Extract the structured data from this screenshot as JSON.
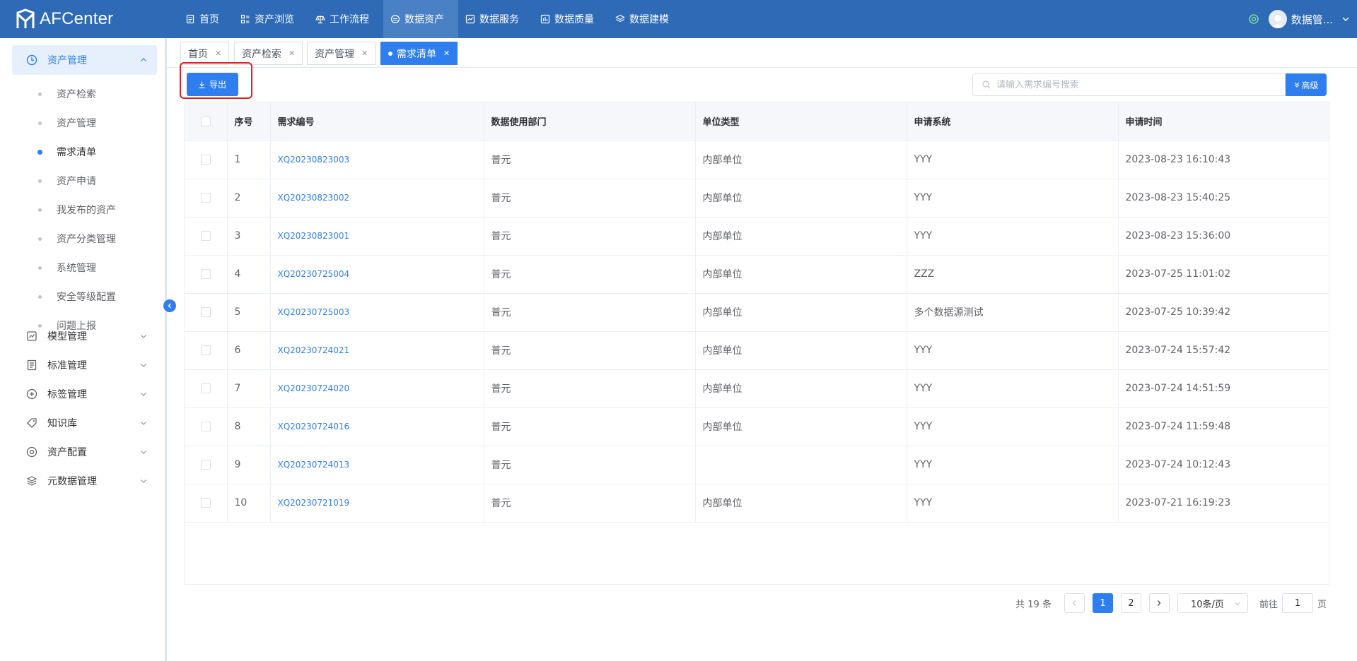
{
  "app": {
    "logo_text": "AFCenter",
    "user_name": "数据管...",
    "accent_color": "#2e7ef0",
    "header_color": "#2e6ab6"
  },
  "nav": [
    {
      "label": "首页",
      "icon": "document-icon",
      "active": false
    },
    {
      "label": "资产浏览",
      "icon": "grid-icon",
      "active": false
    },
    {
      "label": "工作流程",
      "icon": "balance-icon",
      "active": false
    },
    {
      "label": "数据资产",
      "icon": "database-icon",
      "active": true
    },
    {
      "label": "数据服务",
      "icon": "chart-icon",
      "active": false
    },
    {
      "label": "数据质量",
      "icon": "bar-chart-icon",
      "active": false
    },
    {
      "label": "数据建模",
      "icon": "layers-icon",
      "active": false
    }
  ],
  "sidebar": {
    "groups": [
      {
        "label": "资产管理",
        "icon": "clock-icon",
        "expanded": true,
        "active": true
      },
      {
        "label": "模型管理",
        "icon": "chart-box-icon"
      },
      {
        "label": "标准管理",
        "icon": "document-list-icon"
      },
      {
        "label": "标签管理",
        "icon": "plus-circle-icon"
      },
      {
        "label": "知识库",
        "icon": "tag-icon"
      },
      {
        "label": "资产配置",
        "icon": "target-icon"
      },
      {
        "label": "元数据管理",
        "icon": "stack-icon"
      }
    ],
    "sub_items": [
      {
        "label": "资产检索",
        "active": false
      },
      {
        "label": "资产管理",
        "active": false
      },
      {
        "label": "需求清单",
        "active": true
      },
      {
        "label": "资产申请",
        "active": false
      },
      {
        "label": "我发布的资产",
        "active": false
      },
      {
        "label": "资产分类管理",
        "active": false
      },
      {
        "label": "系统管理",
        "active": false
      },
      {
        "label": "安全等级配置",
        "active": false
      },
      {
        "label": "问题上报",
        "active": false
      }
    ]
  },
  "tabs": [
    {
      "label": "首页",
      "active": false
    },
    {
      "label": "资产检索",
      "active": false
    },
    {
      "label": "资产管理",
      "active": false
    },
    {
      "label": "需求清单",
      "active": true
    }
  ],
  "toolbar": {
    "export_label": "导出",
    "search_placeholder": "请输入需求编号搜索",
    "advanced_label": "高级"
  },
  "table": {
    "columns": [
      "序号",
      "需求编号",
      "数据使用部门",
      "单位类型",
      "申请系统",
      "申请时间"
    ],
    "rows": [
      {
        "index": "1",
        "req_no": "XQ20230823003",
        "dept": "普元",
        "unit_type": "内部单位",
        "system": "YYY",
        "time": "2023-08-23 16:10:43"
      },
      {
        "index": "2",
        "req_no": "XQ20230823002",
        "dept": "普元",
        "unit_type": "内部单位",
        "system": "YYY",
        "time": "2023-08-23 15:40:25"
      },
      {
        "index": "3",
        "req_no": "XQ20230823001",
        "dept": "普元",
        "unit_type": "内部单位",
        "system": "YYY",
        "time": "2023-08-23 15:36:00"
      },
      {
        "index": "4",
        "req_no": "XQ20230725004",
        "dept": "普元",
        "unit_type": "内部单位",
        "system": "ZZZ",
        "time": "2023-07-25 11:01:02"
      },
      {
        "index": "5",
        "req_no": "XQ20230725003",
        "dept": "普元",
        "unit_type": "内部单位",
        "system": "多个数据源测试",
        "time": "2023-07-25 10:39:42"
      },
      {
        "index": "6",
        "req_no": "XQ20230724021",
        "dept": "普元",
        "unit_type": "内部单位",
        "system": "YYY",
        "time": "2023-07-24 15:57:42"
      },
      {
        "index": "7",
        "req_no": "XQ20230724020",
        "dept": "普元",
        "unit_type": "内部单位",
        "system": "YYY",
        "time": "2023-07-24 14:51:59"
      },
      {
        "index": "8",
        "req_no": "XQ20230724016",
        "dept": "普元",
        "unit_type": "内部单位",
        "system": "YYY",
        "time": "2023-07-24 11:59:48"
      },
      {
        "index": "9",
        "req_no": "XQ20230724013",
        "dept": "普元",
        "unit_type": "",
        "system": "YYY",
        "time": "2023-07-24 10:12:43"
      },
      {
        "index": "10",
        "req_no": "XQ20230721019",
        "dept": "普元",
        "unit_type": "内部单位",
        "system": "YYY",
        "time": "2023-07-21 16:19:23"
      }
    ]
  },
  "pagination": {
    "total_text": "共 19 条",
    "pages": [
      "1",
      "2"
    ],
    "current_page": "1",
    "page_size_label": "10条/页",
    "goto_prefix": "前往",
    "goto_value": "1",
    "goto_suffix": "页"
  }
}
